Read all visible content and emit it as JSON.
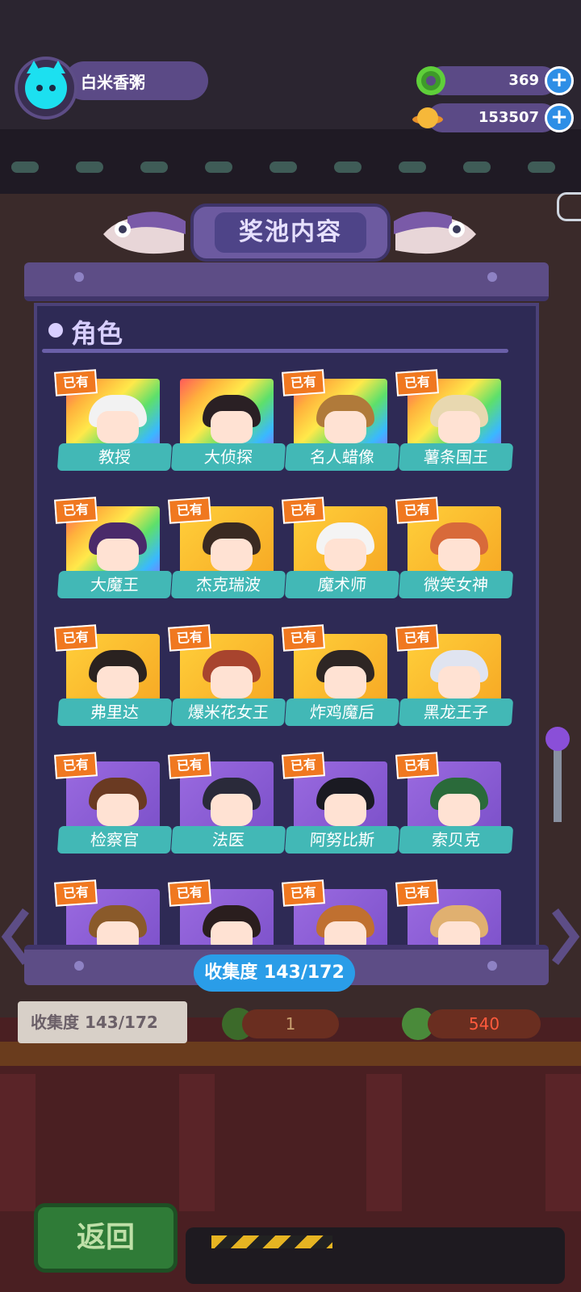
{
  "header": {
    "player_name": "白米香粥",
    "currency_donut": "369",
    "currency_planet": "153507",
    "plus_label": "+"
  },
  "panel": {
    "title": "奖池内容",
    "section_title": "角色",
    "owned_badge": "已有",
    "collection_label": "收集度",
    "collection_value": "143/172"
  },
  "characters": [
    {
      "name": "教授",
      "frame": "rainbow",
      "owned": true
    },
    {
      "name": "大侦探",
      "frame": "rainbow",
      "owned": false
    },
    {
      "name": "名人蜡像",
      "frame": "rainbow",
      "owned": true
    },
    {
      "name": "薯条国王",
      "frame": "rainbow",
      "owned": true
    },
    {
      "name": "大魔王",
      "frame": "rainbow",
      "owned": true
    },
    {
      "name": "杰克瑞波",
      "frame": "gold",
      "owned": true
    },
    {
      "name": "魔术师",
      "frame": "gold",
      "owned": true
    },
    {
      "name": "微笑女神",
      "frame": "gold",
      "owned": true
    },
    {
      "name": "弗里达",
      "frame": "gold",
      "owned": true
    },
    {
      "name": "爆米花女王",
      "frame": "gold",
      "owned": true
    },
    {
      "name": "炸鸡魔后",
      "frame": "gold",
      "owned": true
    },
    {
      "name": "黑龙王子",
      "frame": "gold",
      "owned": true
    },
    {
      "name": "检察官",
      "frame": "purple",
      "owned": true
    },
    {
      "name": "法医",
      "frame": "purple",
      "owned": true
    },
    {
      "name": "阿努比斯",
      "frame": "purple",
      "owned": true
    },
    {
      "name": "索贝克",
      "frame": "purple",
      "owned": true
    },
    {
      "name": "",
      "frame": "purple",
      "owned": true
    },
    {
      "name": "",
      "frame": "purple",
      "owned": true
    },
    {
      "name": "",
      "frame": "purple",
      "owned": true
    },
    {
      "name": "",
      "frame": "purple",
      "owned": true
    }
  ],
  "background": {
    "collection_label": "收集度",
    "collection_value": "143/172",
    "counter_value_1": "1",
    "counter_value_2": "540"
  },
  "footer": {
    "back_label": "返回"
  },
  "colors": {
    "panel": "#5d4d86",
    "panel_body": "#2e2a55",
    "label_teal": "#42b8b6",
    "owned_orange": "#f07820",
    "collect_blue": "#2a9de8",
    "back_green": "#2f7b37"
  }
}
